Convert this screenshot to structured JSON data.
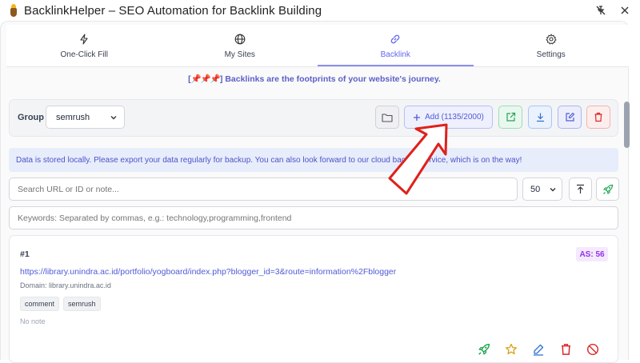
{
  "window": {
    "title": "BacklinkHelper – SEO Automation for Backlink Building"
  },
  "tabs": [
    {
      "label": "One-Click Fill",
      "icon": "lightning-icon"
    },
    {
      "label": "My Sites",
      "icon": "globe-icon"
    },
    {
      "label": "Backlink",
      "icon": "link-icon",
      "active": true
    },
    {
      "label": "Settings",
      "icon": "gear-icon"
    }
  ],
  "tagline": {
    "bracket_open": "[",
    "pins": "📌📌📌",
    "bracket_close": "]",
    "text": "Backlinks are the footprints of your website's journey."
  },
  "group": {
    "label": "Group",
    "selected": "semrush",
    "add_button": "Add (1135/2000)"
  },
  "info": "Data is stored locally. Please export your data regularly for backup. You can also look forward to our cloud backup service, which is on the way!",
  "search": {
    "placeholder": "Search URL or ID or note...",
    "page_size": "50"
  },
  "keywords": {
    "placeholder": "Keywords: Separated by commas, e.g.: technology,programming,frontend"
  },
  "card": {
    "index": "#1",
    "as_badge": "AS: 56",
    "url": "https://library.unindra.ac.id/portfolio/yogboard/index.php?blogger_id=3&route=information%2Fblogger",
    "domain": "Domain: library.unindra.ac.id",
    "tags": [
      "comment",
      "semrush"
    ],
    "note": "No note"
  },
  "colors": {
    "accent": "#6366f1",
    "annotation_arrow": "#e0201b"
  }
}
